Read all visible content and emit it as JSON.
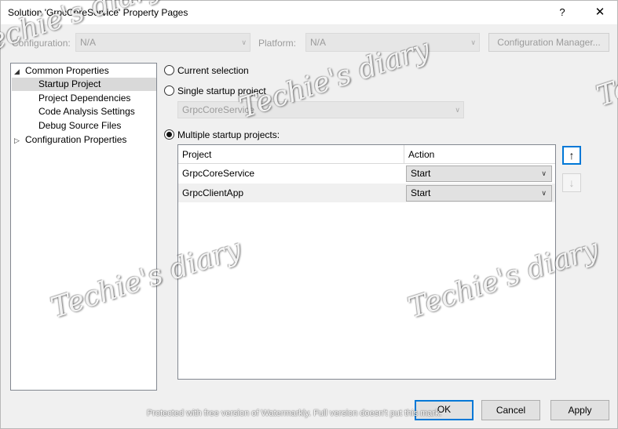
{
  "window": {
    "title": "Solution 'GrpcCoreService' Property Pages",
    "help_label": "?",
    "close_label": "✕"
  },
  "toolbar": {
    "configuration_label": "Configuration:",
    "configuration_value": "N/A",
    "platform_label": "Platform:",
    "platform_value": "N/A",
    "config_manager_label": "Configuration Manager..."
  },
  "tree": {
    "items": [
      {
        "label": "Common Properties",
        "glyph": "◢"
      },
      {
        "label": "Startup Project"
      },
      {
        "label": "Project Dependencies"
      },
      {
        "label": "Code Analysis Settings"
      },
      {
        "label": "Debug Source Files"
      },
      {
        "label": "Configuration Properties",
        "glyph": "▷"
      }
    ]
  },
  "startup": {
    "current_selection_label": "Current selection",
    "single_label": "Single startup project",
    "single_value": "GrpcCoreService",
    "multiple_label": "Multiple startup projects:",
    "selected_option": "multiple"
  },
  "grid": {
    "columns": [
      "Project",
      "Action"
    ],
    "rows": [
      {
        "project": "GrpcCoreService",
        "action": "Start"
      },
      {
        "project": "GrpcClientApp",
        "action": "Start"
      }
    ]
  },
  "side_buttons": {
    "up": "↑",
    "down": "↓"
  },
  "footer": {
    "ok_label": "OK",
    "cancel_label": "Cancel",
    "apply_label": "Apply"
  },
  "watermark": {
    "text": "Techie's diary",
    "notice": "Protected with free version of Watermarkly. Full version doesn't put this mark."
  },
  "colors": {
    "focus": "#0078d7",
    "dialog_bg": "#f0f0f0",
    "selection": "#d9d9d9"
  }
}
